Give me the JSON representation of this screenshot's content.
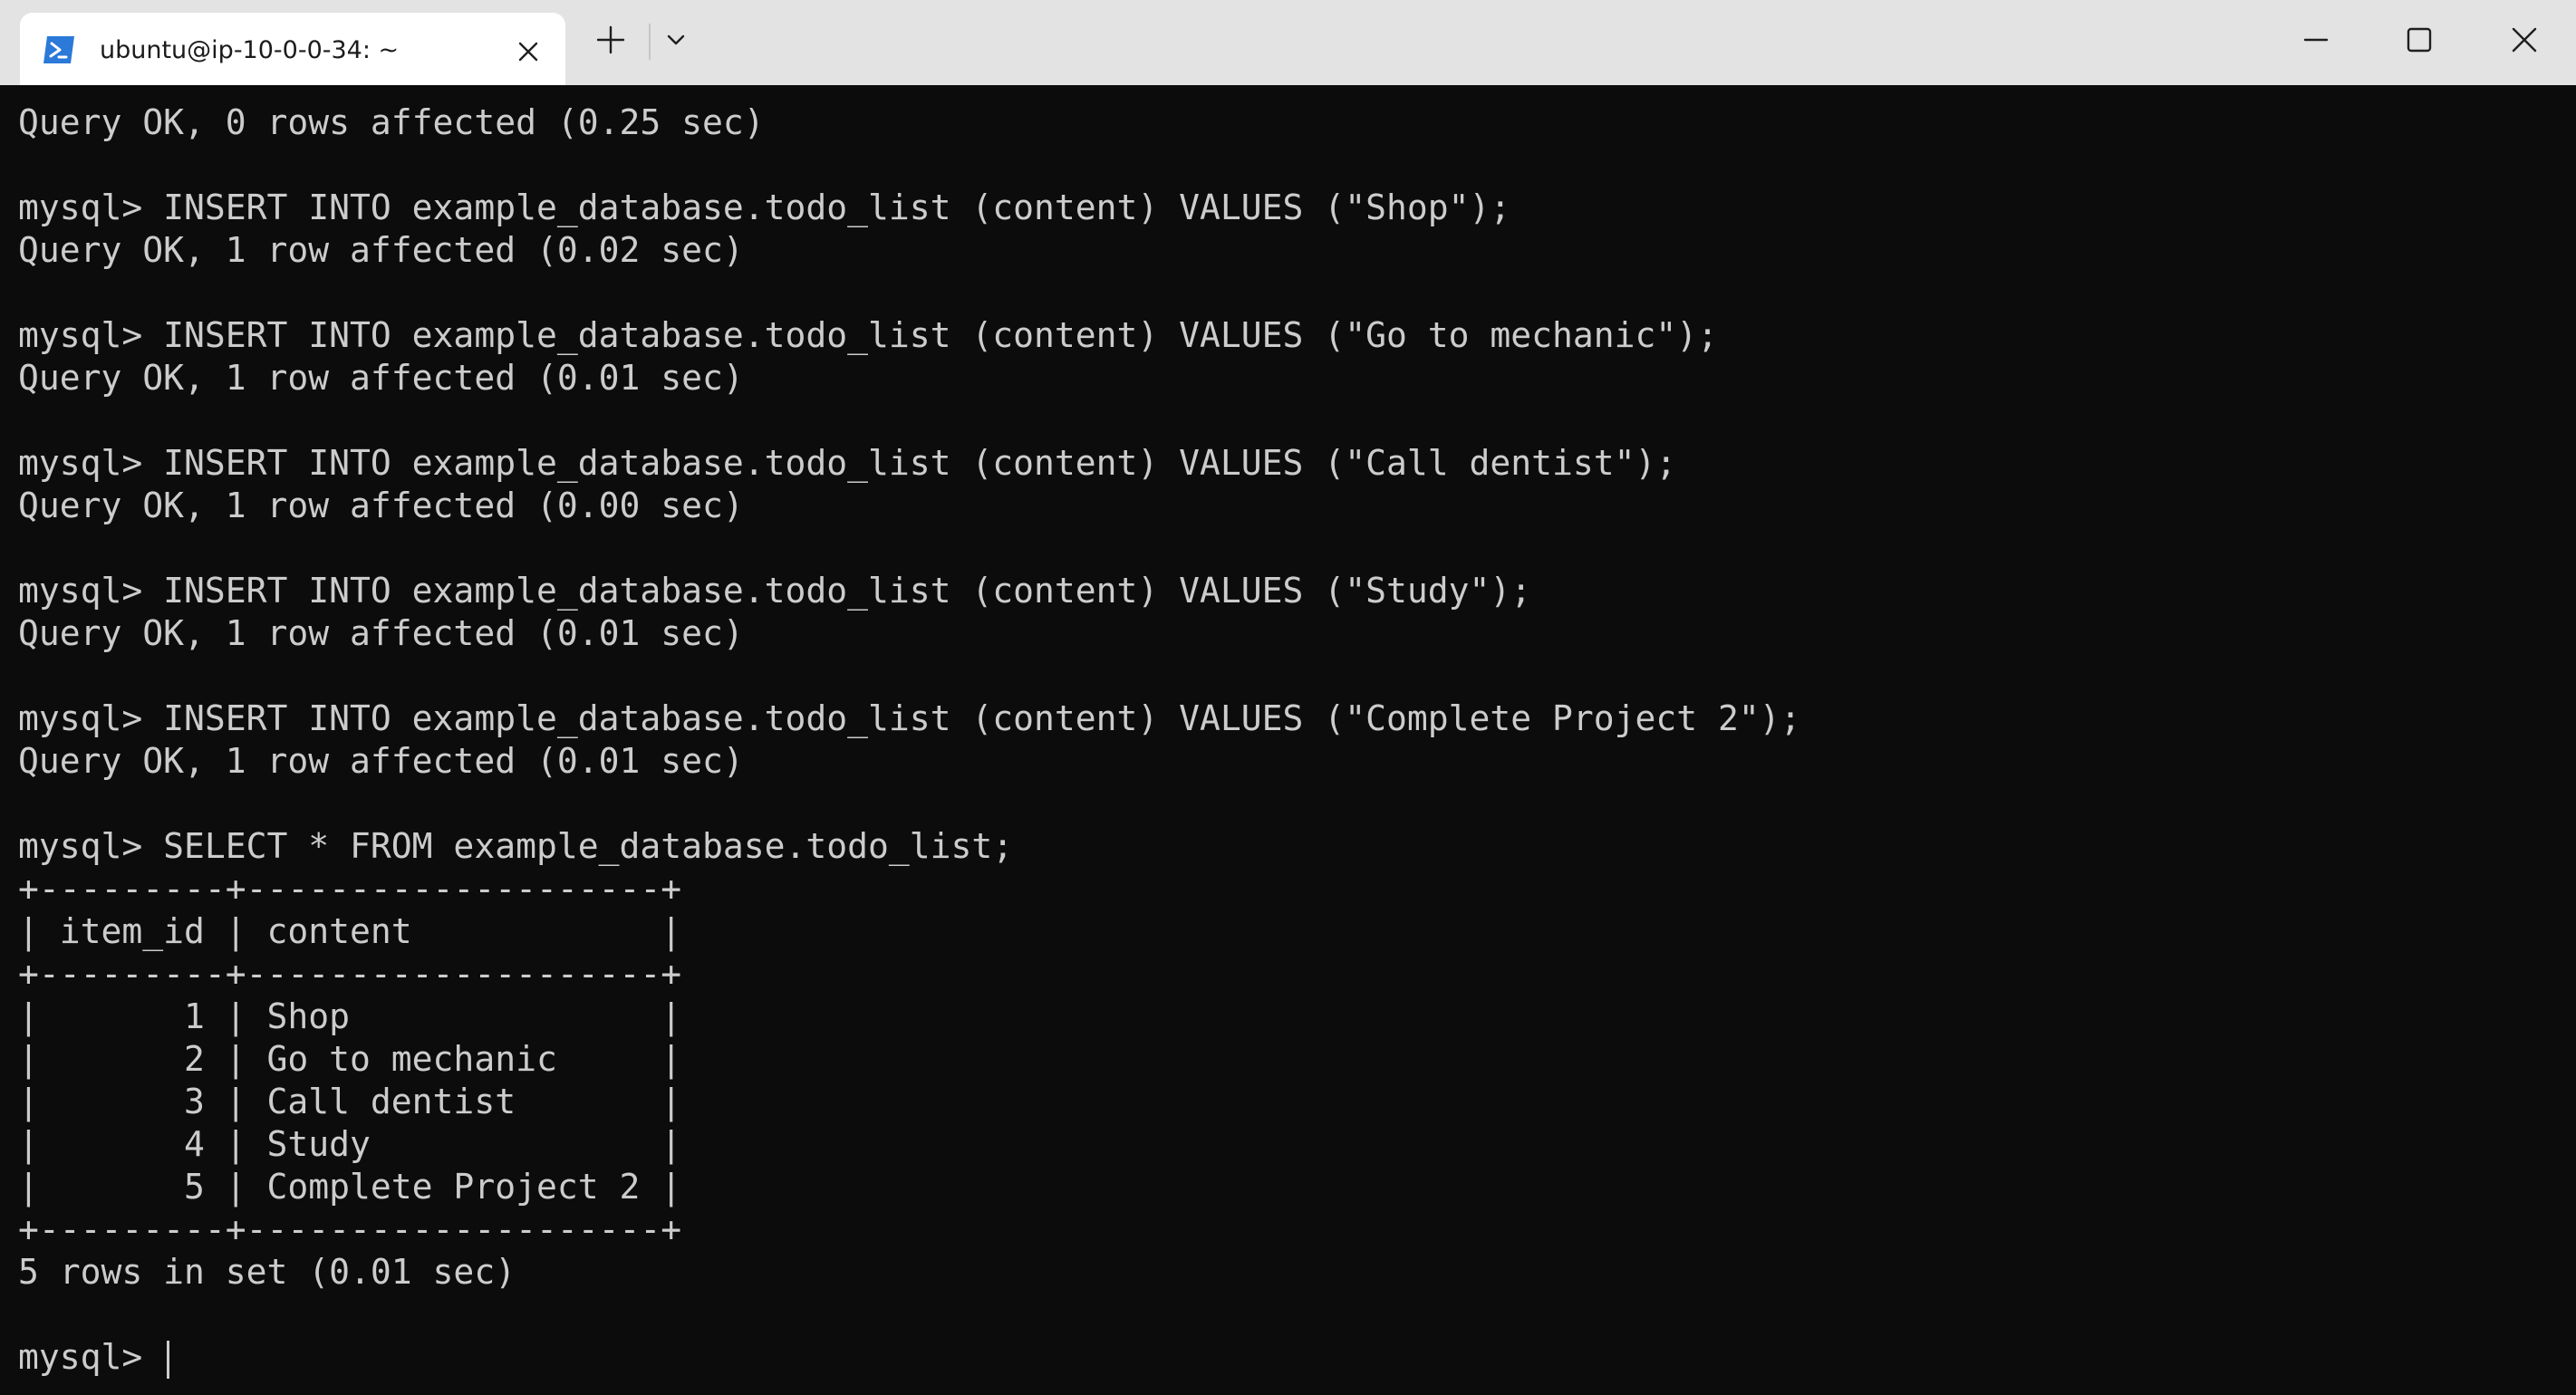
{
  "window": {
    "tab_title": "ubuntu@ip-10-0-0-34: ~",
    "tab_icon": "powershell-icon",
    "controls": {
      "new_tab": "plus-icon",
      "dropdown": "chevron-down-icon",
      "minimize": "minimize-icon",
      "maximize": "maximize-icon",
      "close": "close-icon"
    },
    "colors": {
      "titlebar_bg": "#e3e3e3",
      "tab_bg": "#ffffff",
      "terminal_bg": "#0c0c0c",
      "terminal_fg": "#cccccc",
      "icon_accent": "#2b79d8"
    }
  },
  "terminal": {
    "lines": [
      "Query OK, 0 rows affected (0.25 sec)",
      "",
      "mysql> INSERT INTO example_database.todo_list (content) VALUES (\"Shop\");",
      "Query OK, 1 row affected (0.02 sec)",
      "",
      "mysql> INSERT INTO example_database.todo_list (content) VALUES (\"Go to mechanic\");",
      "Query OK, 1 row affected (0.01 sec)",
      "",
      "mysql> INSERT INTO example_database.todo_list (content) VALUES (\"Call dentist\");",
      "Query OK, 1 row affected (0.00 sec)",
      "",
      "mysql> INSERT INTO example_database.todo_list (content) VALUES (\"Study\");",
      "Query OK, 1 row affected (0.01 sec)",
      "",
      "mysql> INSERT INTO example_database.todo_list (content) VALUES (\"Complete Project 2\");",
      "Query OK, 1 row affected (0.01 sec)",
      "",
      "mysql> SELECT * FROM example_database.todo_list;",
      "+---------+--------------------+",
      "| item_id | content            |",
      "+---------+--------------------+",
      "|       1 | Shop               |",
      "|       2 | Go to mechanic     |",
      "|       3 | Call dentist       |",
      "|       4 | Study              |",
      "|       5 | Complete Project 2 |",
      "+---------+--------------------+",
      "5 rows in set (0.01 sec)",
      ""
    ],
    "prompt": "mysql> "
  }
}
